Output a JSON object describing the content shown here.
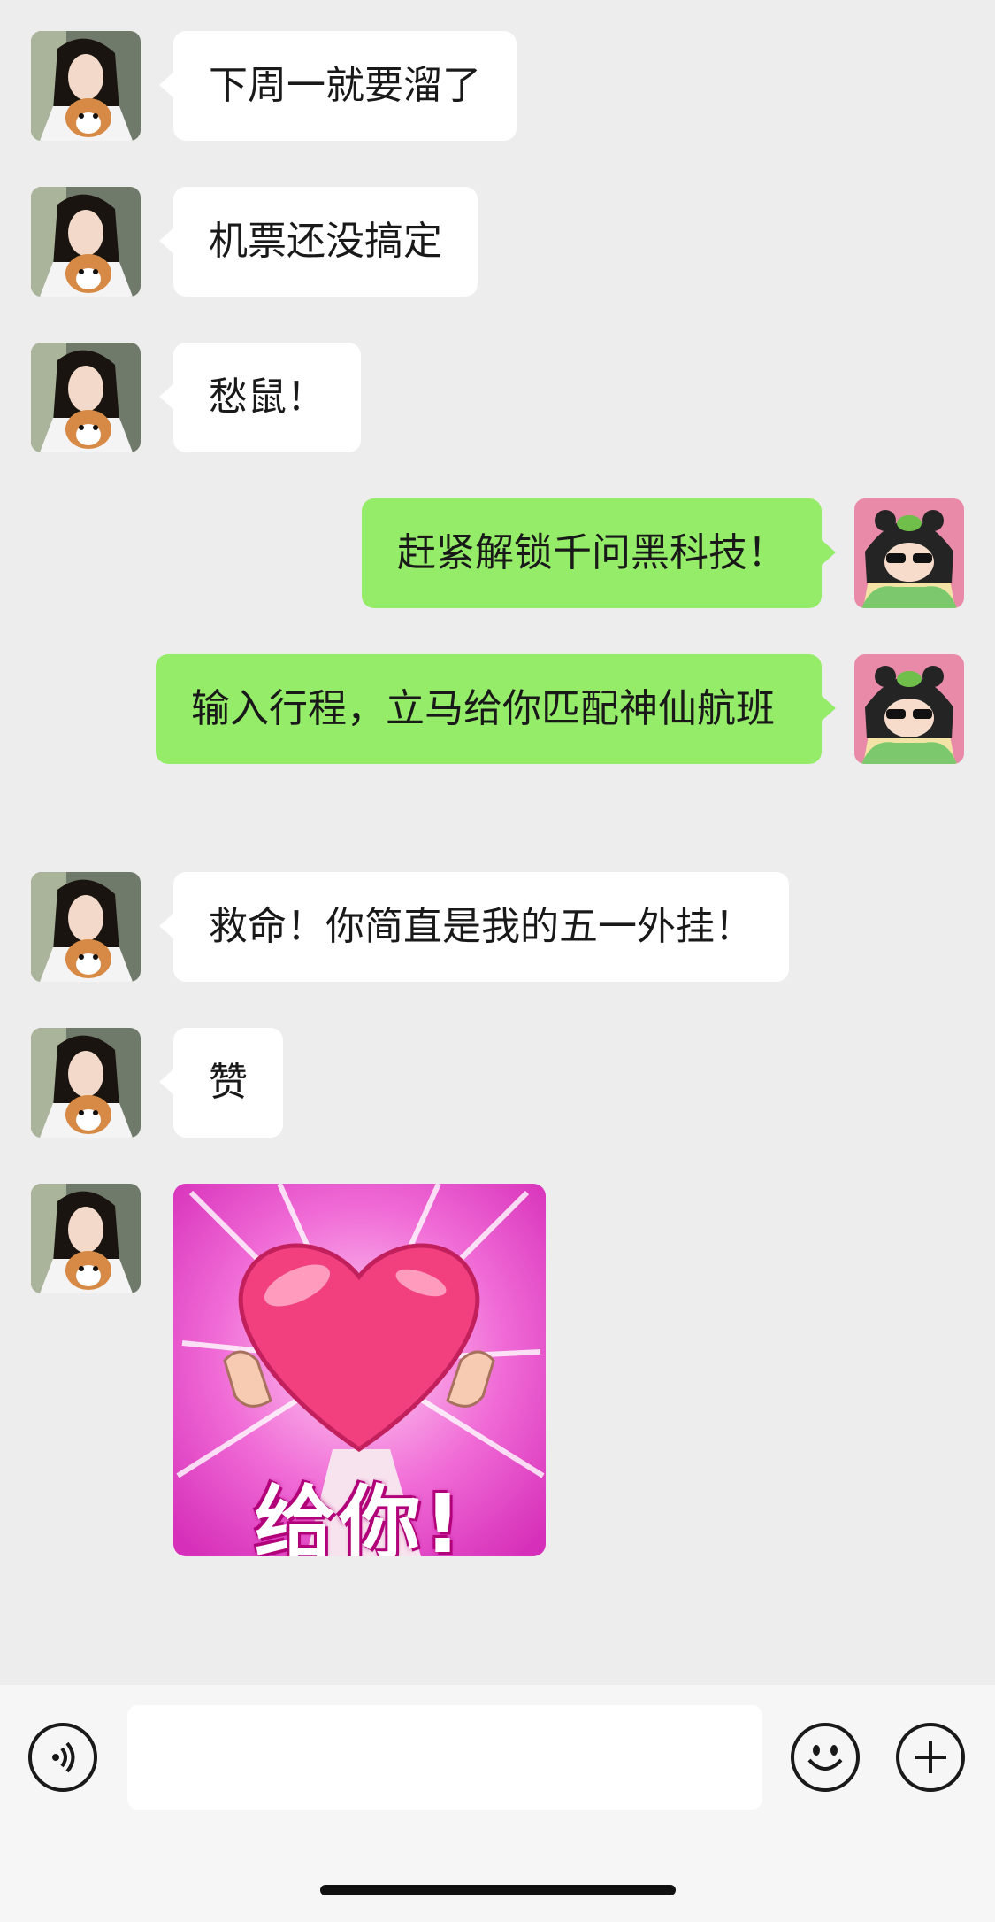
{
  "messages": [
    {
      "side": "in",
      "type": "text",
      "text": "下周一就要溜了"
    },
    {
      "side": "in",
      "type": "text",
      "text": "机票还没搞定"
    },
    {
      "side": "in",
      "type": "text",
      "text": "愁鼠！"
    },
    {
      "side": "out",
      "type": "text",
      "text": "赶紧解锁千问黑科技！"
    },
    {
      "side": "out",
      "type": "text",
      "text": "输入行程，立马给你匹配神仙航班"
    },
    {
      "side": "in",
      "type": "text",
      "text": "救命！你简直是我的五一外挂！"
    },
    {
      "side": "in",
      "type": "text",
      "text": "赞"
    },
    {
      "side": "in",
      "type": "sticker",
      "caption": "给你!"
    }
  ],
  "input_bar": {
    "voice_icon": "voice-icon",
    "emoji_icon": "emoji-icon",
    "plus_icon": "plus-icon",
    "text_value": ""
  },
  "colors": {
    "background": "#ededed",
    "incoming_bubble": "#ffffff",
    "outgoing_bubble": "#95ec69",
    "input_bar": "#f6f6f6"
  }
}
